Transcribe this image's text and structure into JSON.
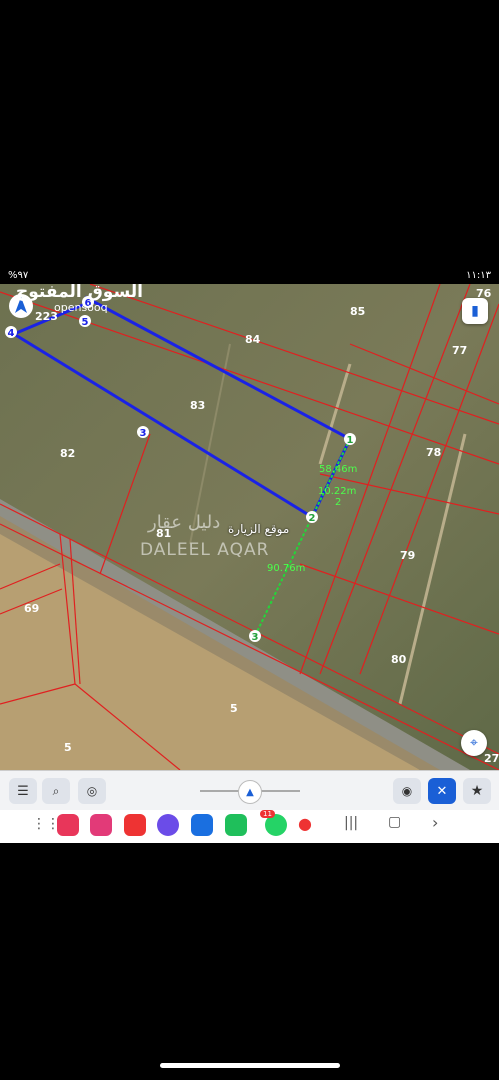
{
  "status_bar": {
    "left": "%٩٧",
    "right": "١١:١٣"
  },
  "watermark": {
    "opensooq_ar": "السوق المفتوح",
    "opensooq_en": "opensooq",
    "daleel_ar": "دليل عقار",
    "daleel_en": "DALEEL AQAR"
  },
  "map": {
    "visit_label": "موقع الزيارة",
    "parcels": [
      "223",
      "85",
      "84",
      "77",
      "76",
      "83",
      "82",
      "78",
      "81",
      "79",
      "69",
      "80",
      "5",
      "5",
      "27"
    ],
    "vertices": [
      "6",
      "5",
      "4",
      "3",
      "1",
      "2"
    ],
    "measure_points": [
      "1",
      "2",
      "3"
    ],
    "distances": [
      "58.46m",
      "10.22m",
      "90.76m"
    ],
    "colors": {
      "boundary": "#e02020",
      "plot_line": "#1a22e6",
      "measure": "#23d63a"
    }
  },
  "toolbar": {
    "icons": [
      "list-icon",
      "search-icon",
      "location-pin-icon",
      "chevron-up-icon",
      "map-marker-icon",
      "tools-icon",
      "star-icon"
    ]
  },
  "navbar": {
    "whatsapp_badge": "11",
    "icons": [
      "grid-icon",
      "camera-icon",
      "flower-icon",
      "flag-icon",
      "browser-icon",
      "chat-icon",
      "phone-icon",
      "whatsapp-icon",
      "maps-icon",
      "recents-icon",
      "home-icon",
      "back-icon"
    ]
  }
}
